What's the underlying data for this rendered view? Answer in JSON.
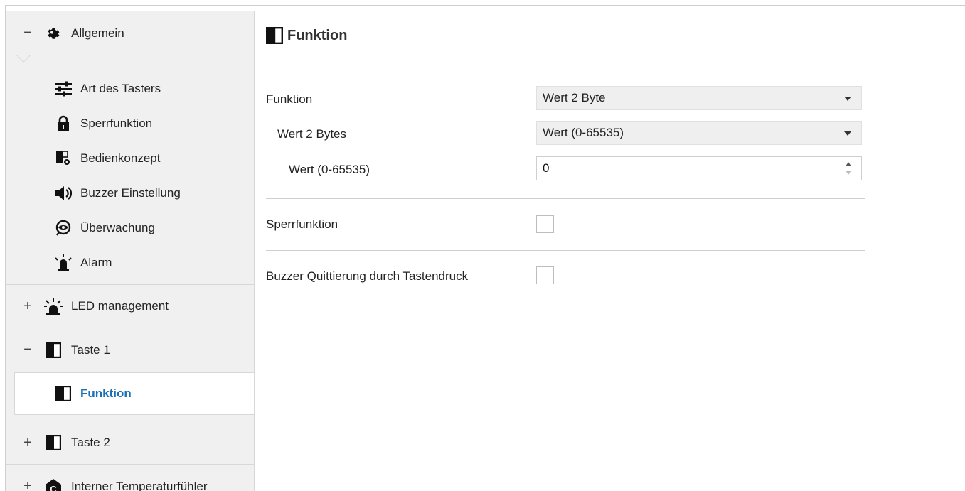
{
  "sidebar": {
    "groups": [
      {
        "toggle": "−",
        "label": "Allgemein",
        "icon": "gear-icon"
      },
      {
        "toggle": "+",
        "label": "LED management",
        "icon": "led-icon"
      },
      {
        "toggle": "−",
        "label": "Taste 1",
        "icon": "half-square-icon"
      },
      {
        "toggle": "+",
        "label": "Taste 2",
        "icon": "half-square-icon"
      },
      {
        "toggle": "+",
        "label": "Interner Temperaturfühler",
        "icon": "temperature-sensor-icon"
      }
    ],
    "allgemein_items": [
      {
        "label": "Art des Tasters",
        "icon": "sliders-icon"
      },
      {
        "label": "Sperrfunktion",
        "icon": "lock-icon"
      },
      {
        "label": "Bedienkonzept",
        "icon": "device-settings-icon"
      },
      {
        "label": "Buzzer Einstellung",
        "icon": "speaker-icon"
      },
      {
        "label": "Überwachung",
        "icon": "eye-icon"
      },
      {
        "label": "Alarm",
        "icon": "alarm-icon"
      }
    ],
    "active_item": {
      "label": "Funktion",
      "icon": "half-square-icon"
    }
  },
  "main": {
    "title": "Funktion",
    "rows": {
      "funktion": {
        "label": "Funktion",
        "value": "Wert 2 Byte"
      },
      "wert2bytes": {
        "label": "Wert 2 Bytes",
        "value": "Wert (0-65535)"
      },
      "wertrange": {
        "label": "Wert (0-65535)",
        "value": "0"
      },
      "sperr": {
        "label": "Sperrfunktion",
        "checked": false
      },
      "buzzer": {
        "label": "Buzzer Quittierung durch Tastendruck",
        "checked": false
      }
    }
  },
  "colors": {
    "accent": "#1a6fb5",
    "sidebar_bg": "#f0f0f0",
    "select_bg": "#efefef"
  }
}
